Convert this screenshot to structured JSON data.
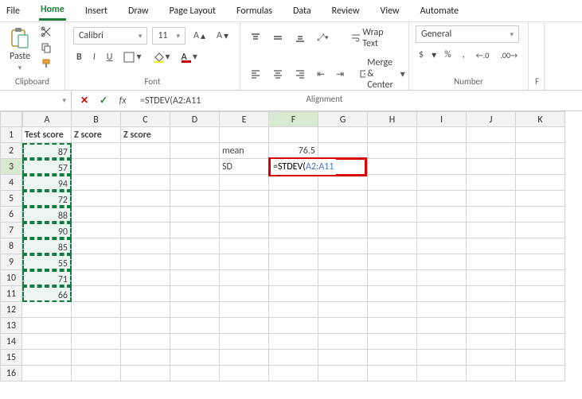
{
  "tabs": {
    "file": "File",
    "home": "Home",
    "insert": "Insert",
    "draw": "Draw",
    "page_layout": "Page Layout",
    "formulas": "Formulas",
    "data": "Data",
    "review": "Review",
    "view": "View",
    "automate": "Automate"
  },
  "clipboard": {
    "paste": "Paste",
    "title": "Clipboard"
  },
  "font": {
    "name": "Calibri",
    "size": "11",
    "title": "Font",
    "bold": "B",
    "italic": "I",
    "underline": "U"
  },
  "alignment": {
    "wrap": "Wrap Text",
    "merge": "Merge & Center",
    "title": "Alignment"
  },
  "number": {
    "format": "General",
    "currency": "$",
    "percent": "%",
    "comma": ",",
    "dec_inc": ".00",
    "dec_dec": ".0",
    "title": "Number",
    "f_label": "F"
  },
  "formula_bar": {
    "namebox": "",
    "fx": "fx",
    "value": "=STDEV(A2:A11"
  },
  "columns": [
    "A",
    "B",
    "C",
    "D",
    "E",
    "F",
    "G",
    "H",
    "I",
    "J",
    "K"
  ],
  "headers": {
    "a1": "Test score",
    "b1": "Z score",
    "c1": "Z score"
  },
  "data_a": [
    "87",
    "57",
    "94",
    "72",
    "88",
    "90",
    "85",
    "55",
    "71",
    "66"
  ],
  "e_cells": {
    "e2": "mean",
    "e3": "SD"
  },
  "f_cells": {
    "f2": "76.5"
  },
  "formula_edit": {
    "prefix": "=STDEV(",
    "range": "A2:A11"
  },
  "chart_data": {
    "type": "table",
    "columns": [
      "Test score"
    ],
    "values": [
      87,
      57,
      94,
      72,
      88,
      90,
      85,
      55,
      71,
      66
    ],
    "derived": {
      "mean": 76.5,
      "sd_formula": "=STDEV(A2:A11"
    }
  }
}
